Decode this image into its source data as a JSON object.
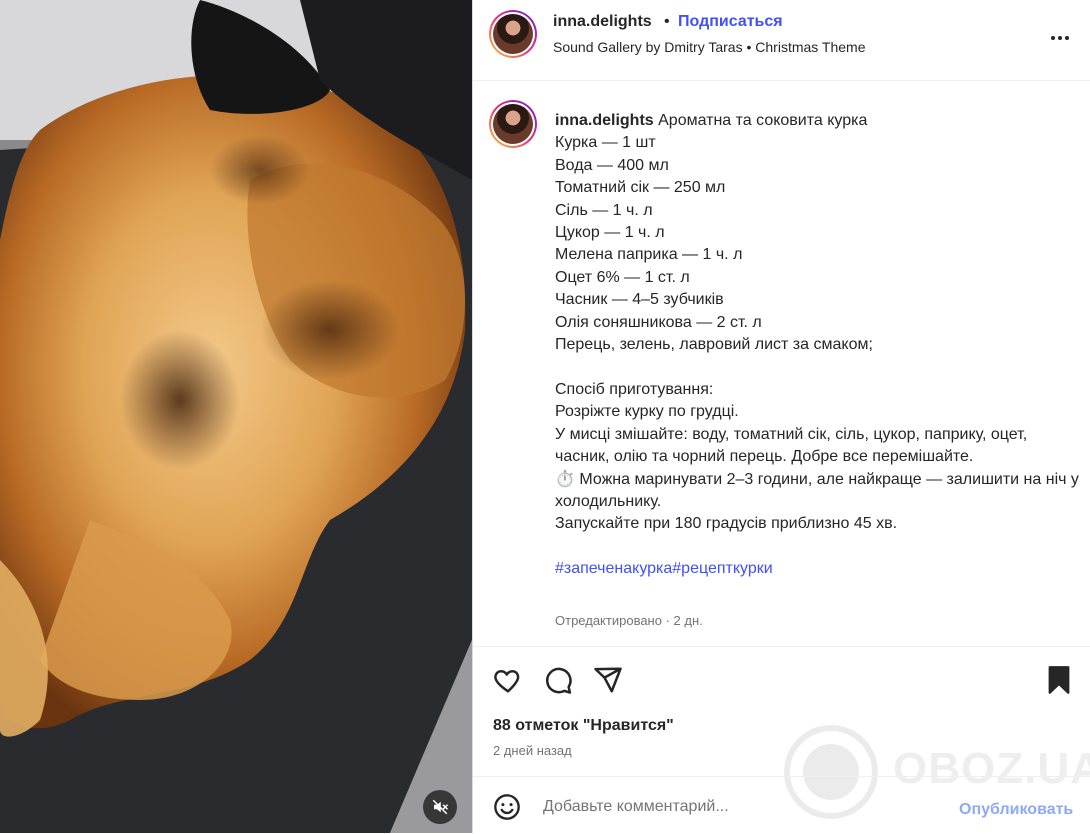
{
  "post": {
    "username": "inna.delights",
    "follow_label": "Подписаться",
    "dot": "•",
    "audio": "Sound Gallery by Dmitry Taras • Christmas Theme",
    "caption_title": "Ароматна та соковита курка",
    "caption_body": "Курка — 1 шт\nВода — 400 мл\nТоматний сік — 250 мл\nСіль — 1 ч. л\nЦукор — 1 ч. л\nМелена паприка — 1 ч. л\nОцет 6% — 1 ст. л\nЧасник — 4–5 зубчиків\nОлія соняшникова — 2 ст. л\nПерець, зелень, лавровий лист за смаком;\n\nСпосіб приготування:\nРозріжте курку по грудці.\nУ мисці змішайте: воду, томатний сік, сіль, цукор, паприку, оцет, часник, олію та чорний перець. Добре все перемішайте.\n⏱️ Можна маринувати 2–3 години, але найкраще — залишити на ніч у холодильнику.\nЗапускайте при 180 градусів приблизно 45 хв.\n\n",
    "hashtags": "#запеченакурка#рецепткурки",
    "edited": "Отредактировано · 2 дн.",
    "likes": "88 отметок \"Нравится\"",
    "time_ago": "2 дней назад",
    "comment_placeholder": "Добавьте комментарий...",
    "publish_label": "Опубликовать"
  },
  "watermark": {
    "text": "OBOZ.UA"
  },
  "colors": {
    "accent": "#4150f7",
    "text": "#262626",
    "muted": "#737373",
    "publish_disabled": "#8fa8f7"
  },
  "icons": [
    "volume-muted-icon",
    "more-options-icon",
    "heart-icon",
    "comment-icon",
    "share-icon",
    "bookmark-icon",
    "emoji-icon"
  ]
}
